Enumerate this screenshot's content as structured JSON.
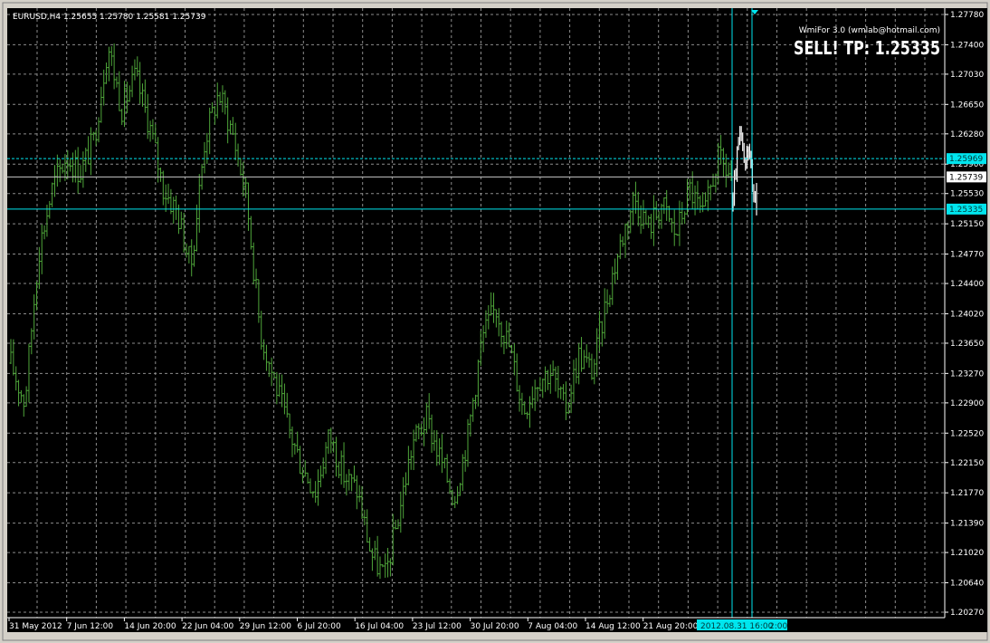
{
  "window": {
    "symbol_header": "EURUSD,H4  1.25655 1.25780 1.25581 1.25739"
  },
  "indicator": {
    "credit": "WmiFor 3.0 (wmlab@hotmail.com)",
    "signal": "SELL!  TP: 1.25335"
  },
  "colors": {
    "background": "#000000",
    "grid": "#8c8c8c",
    "bars": "#4fa63a",
    "forecast": "#ffffff",
    "cyan": "#00e5ee",
    "axis_text": "#ffffff"
  },
  "marker": {
    "time_label": "2012.08.31 16:00",
    "offset_label": "2:00"
  },
  "price_lines": [
    {
      "label": "1.25969",
      "style": "dashed-cyan"
    },
    {
      "label": "1.25739",
      "style": "solid-white"
    },
    {
      "label": "1.25335",
      "style": "solid-cyan"
    }
  ],
  "chart_data": {
    "type": "ohlc",
    "title": "EURUSD,H4",
    "series": [
      {
        "name": "EURUSD",
        "values": [
          1.234,
          1.229,
          1.248,
          1.256,
          1.26,
          1.258,
          1.262,
          1.274,
          1.266,
          1.27,
          1.264,
          1.256,
          1.253,
          1.246,
          1.262,
          1.268,
          1.263,
          1.255,
          1.238,
          1.232,
          1.226,
          1.221,
          1.218,
          1.225,
          1.22,
          1.218,
          1.21,
          1.207,
          1.215,
          1.224,
          1.227,
          1.222,
          1.217,
          1.225,
          1.237,
          1.241,
          1.236,
          1.228,
          1.232,
          1.233,
          1.228,
          1.235,
          1.233,
          1.242,
          1.249,
          1.255,
          1.251,
          1.254,
          1.25,
          1.256,
          1.252,
          1.2597,
          1.2574
        ]
      }
    ],
    "yticks": [
      "1.27780",
      "1.27400",
      "1.27030",
      "1.26650",
      "1.26280",
      "1.25900",
      "1.25530",
      "1.25150",
      "1.24770",
      "1.24400",
      "1.24020",
      "1.23650",
      "1.23270",
      "1.22900",
      "1.22520",
      "1.22150",
      "1.21770",
      "1.21390",
      "1.21020",
      "1.20640",
      "1.20270"
    ],
    "xticks": [
      "31 May 2012",
      "7 Jun 12:00",
      "14 Jun 20:00",
      "22 Jun 04:00",
      "29 Jun 12:00",
      "6 Jul 20:00",
      "16 Jul 04:00",
      "23 Jul 12:00",
      "30 Jul 20:00",
      "7 Aug 04:00",
      "14 Aug 12:00",
      "21 Aug 20:00"
    ],
    "ylim": [
      1.2027,
      1.2778
    ],
    "grid": true,
    "forecast": {
      "name": "WmiFor",
      "values": [
        1.254,
        1.26,
        1.263,
        1.258,
        1.262,
        1.256,
        1.254
      ]
    }
  }
}
